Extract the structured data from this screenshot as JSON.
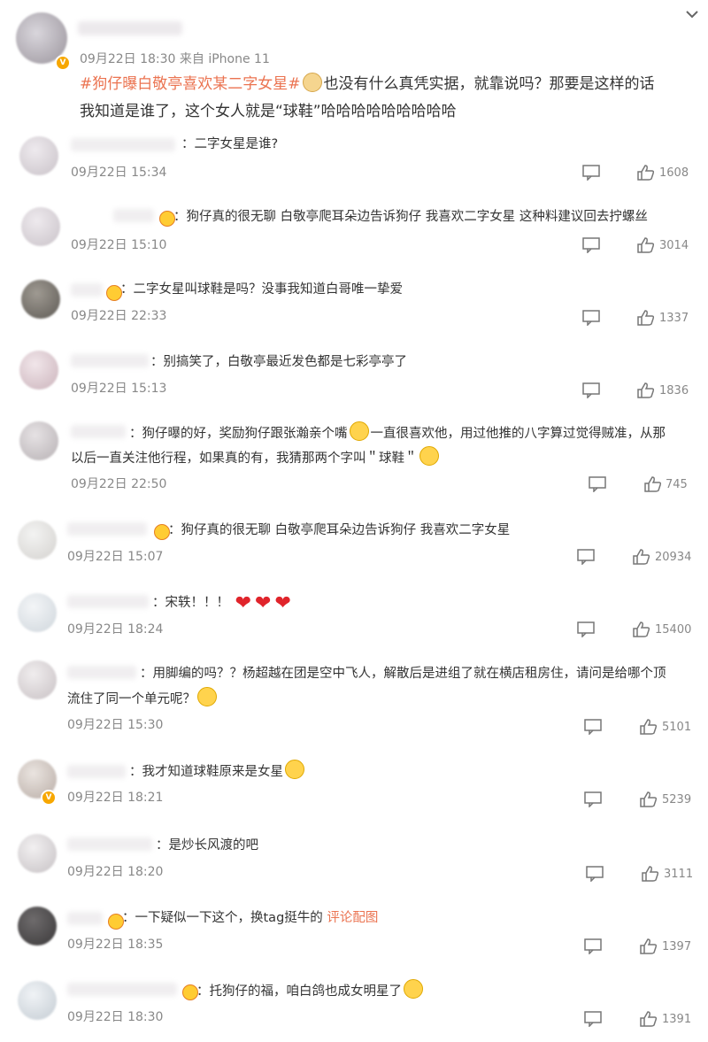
{
  "post": {
    "meta": "09月22日 18:30  来自 iPhone 11",
    "topic": "#狗仔曝白敬亭喜欢某二字女星#",
    "line1_rest": "也没有什么真凭实据，就靠说吗？那要是这样的话",
    "line2": "我知道是谁了，这个女人就是“球鞋”哈哈哈哈哈哈哈哈哈"
  },
  "comments": [
    {
      "text": "：二字女星是谁?",
      "time": "09月22日 15:34",
      "likes": "1608"
    },
    {
      "text": "：狗仔真的很无聊 白敬亭爬耳朵边告诉狗仔 我喜欢二字女星 这种料建议回去拧螺丝",
      "time": "09月22日 15:10",
      "likes": "3014"
    },
    {
      "text": "：二字女星叫球鞋是吗？没事我知道白哥唯一挚爱",
      "time": "09月22日 22:33",
      "likes": "1337"
    },
    {
      "text": "：别搞笑了，白敬亭最近发色都是七彩亭亭了",
      "time": "09月22日 15:13",
      "likes": "1836"
    },
    {
      "text_a": "：狗仔曝的好，奖励狗仔跟张瀚亲个嘴",
      "text_b": "一直很喜欢他，用过他推的八字算过觉得贼准，从那",
      "text_c": "以后一直关注他行程，如果真的有，我猜那两个字叫＂球鞋＂",
      "time": "09月22日 22:50",
      "likes": "745"
    },
    {
      "text": "：狗仔真的很无聊 白敬亭爬耳朵边告诉狗仔 我喜欢二字女星",
      "time": "09月22日 15:07",
      "likes": "20934"
    },
    {
      "text": "：宋轶！！！",
      "time": "09月22日 18:24",
      "likes": "15400"
    },
    {
      "text_a": "：用脚编的吗？？杨超越在团是空中飞人，解散后是进组了就在横店租房住，请问是给哪个顶",
      "text_b": "流住了同一个单元呢？",
      "time": "09月22日 15:30",
      "likes": "5101"
    },
    {
      "text": "：我才知道球鞋原来是女星",
      "time": "09月22日 18:21",
      "likes": "5239"
    },
    {
      "text": "：是炒长风渡的吧",
      "time": "09月22日 18:20",
      "likes": "3111"
    },
    {
      "text": "：一下疑似一下这个，换tag挺牛的",
      "link": "评论配图",
      "time": "09月22日 18:35",
      "likes": "1397"
    },
    {
      "text": "：托狗仔的福，咱白鸽也成女明星了",
      "time": "09月22日 18:30",
      "likes": "1391"
    }
  ],
  "icons": {
    "reply": "comment-icon",
    "like": "thumbs-up-icon",
    "collapse": "chevron-down-icon"
  },
  "colors": {
    "topic": "#eb7350",
    "text": "#333333",
    "meta": "#888888"
  }
}
